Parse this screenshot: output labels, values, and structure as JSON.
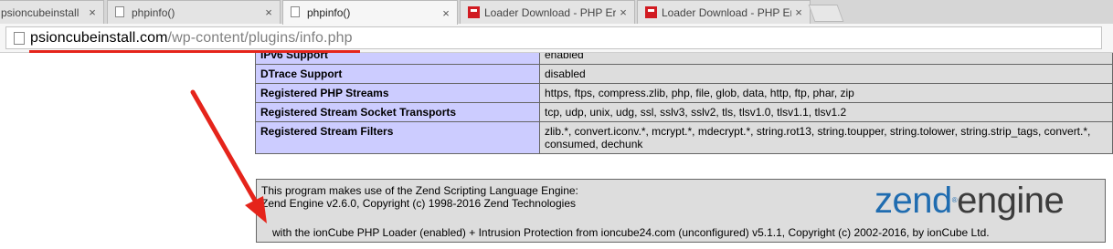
{
  "tabs": [
    {
      "label": "psioncubeinstall",
      "close": "×",
      "icon": "document-icon"
    },
    {
      "label": "phpinfo()",
      "close": "×",
      "icon": "document-icon"
    },
    {
      "label": "phpinfo()",
      "close": "×",
      "icon": "document-icon",
      "active": true
    },
    {
      "label": "Loader Download - PHP Er",
      "close": "×",
      "icon": "ioncube-icon"
    },
    {
      "label": "Loader Download - PHP Er",
      "close": "×",
      "icon": "ioncube-icon"
    }
  ],
  "address_bar": {
    "host": "psioncubeinstall.com",
    "path": "/wp-content/plugins/info.php"
  },
  "rows": [
    {
      "name": "IPv6 Support",
      "value": "enabled"
    },
    {
      "name": "DTrace Support",
      "value": "disabled"
    },
    {
      "name": "Registered PHP Streams",
      "value": "https, ftps, compress.zlib, php, file, glob, data, http, ftp, phar, zip"
    },
    {
      "name": "Registered Stream Socket Transports",
      "value": "tcp, udp, unix, udg, ssl, sslv3, sslv2, tls, tlsv1.0, tlsv1.1, tlsv1.2"
    },
    {
      "name": "Registered Stream Filters",
      "value": "zlib.*, convert.iconv.*, mcrypt.*, mdecrypt.*, string.rot13, string.toupper, string.tolower, string.strip_tags, convert.*, consumed, dechunk"
    }
  ],
  "zend": {
    "line1": "This program makes use of the Zend Scripting Language Engine:",
    "line2": "Zend Engine v2.6.0, Copyright (c) 1998-2016 Zend Technologies",
    "line3": "with the ionCube PHP Loader (enabled) + Intrusion Protection from ioncube24.com (unconfigured) v5.1.1, Copyright (c) 2002-2016, by ionCube Ltd.",
    "logo_zend": "zend",
    "logo_reg": "®",
    "logo_engine": "engine"
  },
  "colors": {
    "annotation": "#e5241b",
    "label_cell": "#ccccff",
    "value_cell": "#dddddd",
    "zend_blue": "#1f6cb0"
  }
}
